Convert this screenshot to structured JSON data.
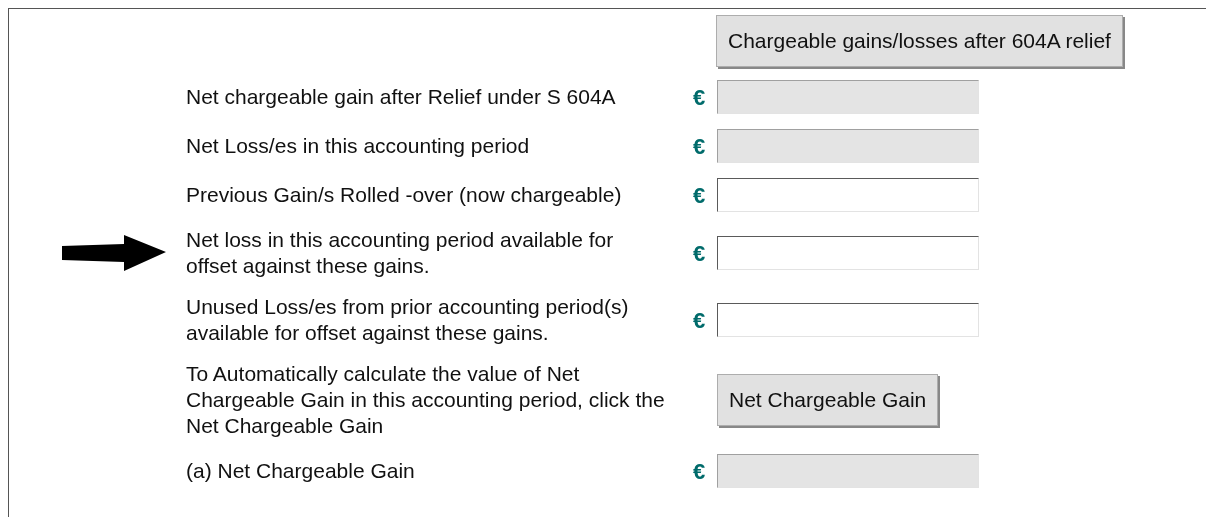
{
  "top_button": "Chargeable gains/losses after 604A relief",
  "rows": [
    {
      "kind": "field",
      "label": "Net chargeable gain after Relief under S 604A",
      "currency": "€",
      "disabled": true,
      "arrow": false
    },
    {
      "kind": "field",
      "label": "Net Loss/es in this accounting period",
      "currency": "€",
      "disabled": true,
      "arrow": false
    },
    {
      "kind": "field",
      "label": "Previous Gain/s Rolled -over (now chargeable)",
      "currency": "€",
      "disabled": false,
      "arrow": false
    },
    {
      "kind": "field",
      "label": "Net loss in this accounting period available for offset against these gains.",
      "currency": "€",
      "disabled": false,
      "arrow": true
    },
    {
      "kind": "field",
      "label": "Unused Loss/es from prior accounting period(s) available for offset against these gains.",
      "currency": "€",
      "disabled": false,
      "arrow": false
    },
    {
      "kind": "button",
      "label": "To Automatically calculate the value of Net Chargeable Gain in this accounting period, click the Net Chargeable Gain",
      "button": "Net Chargeable Gain",
      "arrow": false
    },
    {
      "kind": "field",
      "label": "(a) Net Chargeable Gain",
      "currency": "€",
      "disabled": true,
      "arrow": false
    }
  ]
}
